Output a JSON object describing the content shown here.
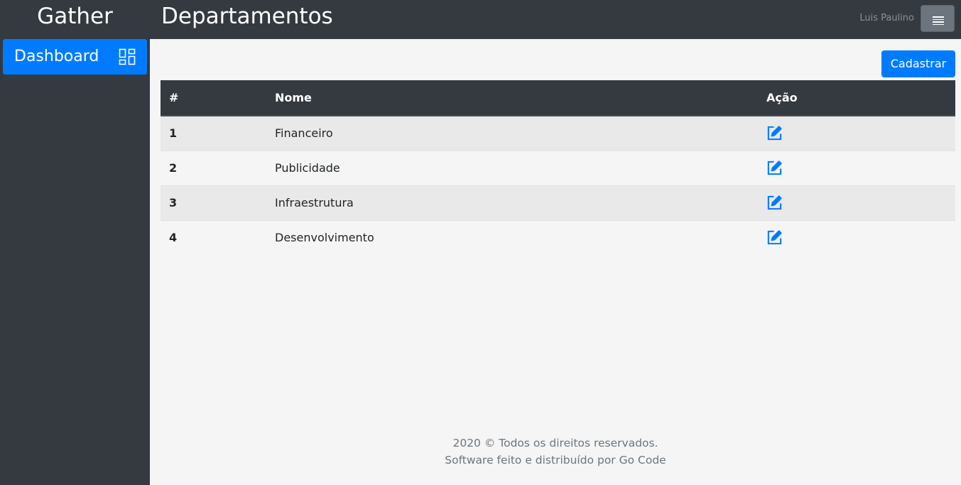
{
  "app": {
    "brand": "Gather",
    "page_title": "Departamentos",
    "user_name": "Luis Paulino"
  },
  "sidebar": {
    "items": [
      {
        "label": "Dashboard",
        "icon": "dashboard-icon"
      }
    ]
  },
  "toolbar": {
    "add_label": "Cadastrar"
  },
  "table": {
    "headers": {
      "index": "#",
      "name": "Nome",
      "action": "Ação"
    },
    "rows": [
      {
        "index": "1",
        "name": "Financeiro",
        "action_icon": "edit-icon"
      },
      {
        "index": "2",
        "name": "Publicidade",
        "action_icon": "edit-icon"
      },
      {
        "index": "3",
        "name": "Infraestrutura",
        "action_icon": "edit-icon"
      },
      {
        "index": "4",
        "name": "Desenvolvimento",
        "action_icon": "edit-icon"
      }
    ]
  },
  "footer": {
    "line1": "2020 © Todos os direitos reservados.",
    "line2": "Software feito e distribuído por Go Code"
  },
  "colors": {
    "primary": "#007bff",
    "dark": "#343a40",
    "secondary": "#6c757d",
    "background": "#f5f5f5"
  }
}
